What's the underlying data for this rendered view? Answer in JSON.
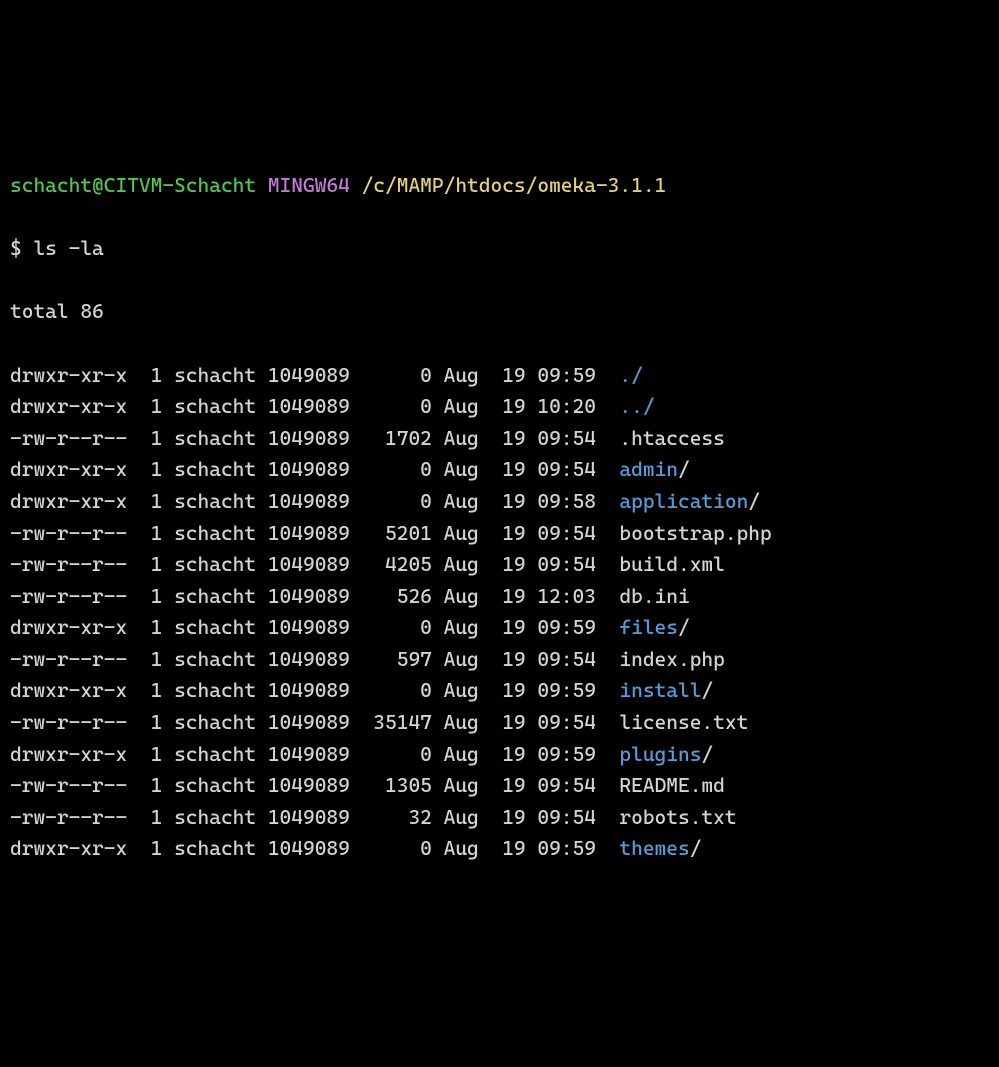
{
  "prompt": {
    "user_host": "schacht@CITVM-Schacht",
    "shell": "MINGW64",
    "cwd": "/c/MAMP/htdocs/omeka-3.1.1",
    "symbol": "$",
    "command": "ls -la"
  },
  "output": {
    "total_line": "total 86",
    "entries": [
      {
        "perm": "drwxr-xr-x",
        "links": "1",
        "owner": "schacht",
        "group": "1049089",
        "size": "0",
        "month": "Aug",
        "day": "19",
        "time": "09:59",
        "name": "./",
        "dir": true
      },
      {
        "perm": "drwxr-xr-x",
        "links": "1",
        "owner": "schacht",
        "group": "1049089",
        "size": "0",
        "month": "Aug",
        "day": "19",
        "time": "10:20",
        "name": "../",
        "dir": true
      },
      {
        "perm": "-rw-r--r--",
        "links": "1",
        "owner": "schacht",
        "group": "1049089",
        "size": "1702",
        "month": "Aug",
        "day": "19",
        "time": "09:54",
        "name": ".htaccess",
        "dir": false
      },
      {
        "perm": "drwxr-xr-x",
        "links": "1",
        "owner": "schacht",
        "group": "1049089",
        "size": "0",
        "month": "Aug",
        "day": "19",
        "time": "09:54",
        "name": "admin/",
        "nameBase": "admin",
        "suffix": "/",
        "dir": true
      },
      {
        "perm": "drwxr-xr-x",
        "links": "1",
        "owner": "schacht",
        "group": "1049089",
        "size": "0",
        "month": "Aug",
        "day": "19",
        "time": "09:58",
        "name": "application/",
        "nameBase": "application",
        "suffix": "/",
        "dir": true
      },
      {
        "perm": "-rw-r--r--",
        "links": "1",
        "owner": "schacht",
        "group": "1049089",
        "size": "5201",
        "month": "Aug",
        "day": "19",
        "time": "09:54",
        "name": "bootstrap.php",
        "dir": false
      },
      {
        "perm": "-rw-r--r--",
        "links": "1",
        "owner": "schacht",
        "group": "1049089",
        "size": "4205",
        "month": "Aug",
        "day": "19",
        "time": "09:54",
        "name": "build.xml",
        "dir": false
      },
      {
        "perm": "-rw-r--r--",
        "links": "1",
        "owner": "schacht",
        "group": "1049089",
        "size": "526",
        "month": "Aug",
        "day": "19",
        "time": "12:03",
        "name": "db.ini",
        "dir": false
      },
      {
        "perm": "drwxr-xr-x",
        "links": "1",
        "owner": "schacht",
        "group": "1049089",
        "size": "0",
        "month": "Aug",
        "day": "19",
        "time": "09:59",
        "name": "files/",
        "nameBase": "files",
        "suffix": "/",
        "dir": true
      },
      {
        "perm": "-rw-r--r--",
        "links": "1",
        "owner": "schacht",
        "group": "1049089",
        "size": "597",
        "month": "Aug",
        "day": "19",
        "time": "09:54",
        "name": "index.php",
        "dir": false
      },
      {
        "perm": "drwxr-xr-x",
        "links": "1",
        "owner": "schacht",
        "group": "1049089",
        "size": "0",
        "month": "Aug",
        "day": "19",
        "time": "09:59",
        "name": "install/",
        "nameBase": "install",
        "suffix": "/",
        "dir": true
      },
      {
        "perm": "-rw-r--r--",
        "links": "1",
        "owner": "schacht",
        "group": "1049089",
        "size": "35147",
        "month": "Aug",
        "day": "19",
        "time": "09:54",
        "name": "license.txt",
        "dir": false
      },
      {
        "perm": "drwxr-xr-x",
        "links": "1",
        "owner": "schacht",
        "group": "1049089",
        "size": "0",
        "month": "Aug",
        "day": "19",
        "time": "09:59",
        "name": "plugins/",
        "nameBase": "plugins",
        "suffix": "/",
        "dir": true
      },
      {
        "perm": "-rw-r--r--",
        "links": "1",
        "owner": "schacht",
        "group": "1049089",
        "size": "1305",
        "month": "Aug",
        "day": "19",
        "time": "09:54",
        "name": "README.md",
        "dir": false
      },
      {
        "perm": "-rw-r--r--",
        "links": "1",
        "owner": "schacht",
        "group": "1049089",
        "size": "32",
        "month": "Aug",
        "day": "19",
        "time": "09:54",
        "name": "robots.txt",
        "dir": false
      },
      {
        "perm": "drwxr-xr-x",
        "links": "1",
        "owner": "schacht",
        "group": "1049089",
        "size": "0",
        "month": "Aug",
        "day": "19",
        "time": "09:59",
        "name": "themes/",
        "nameBase": "themes",
        "suffix": "/",
        "dir": true
      }
    ]
  }
}
